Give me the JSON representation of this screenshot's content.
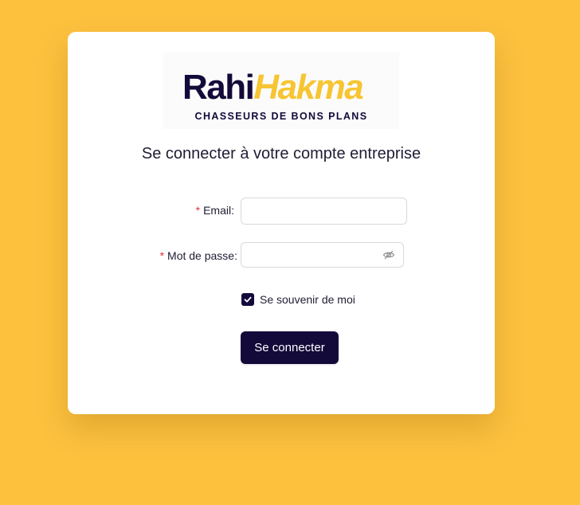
{
  "colors": {
    "background": "#fdc13e",
    "brand_dark": "#140a3a",
    "brand_yellow": "#f7c531",
    "required_star": "#e0353a"
  },
  "logo": {
    "word_dark": "Rahi",
    "word_yellow": "Hakma",
    "tagline": "CHASSEURS DE BONS PLANS"
  },
  "heading": "Se connecter à votre compte entreprise",
  "form": {
    "email": {
      "required_mark": "*",
      "label": "Email",
      "colon": ":",
      "value": ""
    },
    "password": {
      "required_mark": "*",
      "label": "Mot de passe",
      "colon": ":",
      "value": "",
      "toggle_icon": "eye-invisible-icon"
    },
    "remember": {
      "label": "Se souvenir de moi",
      "checked": true
    },
    "submit_label": "Se connecter"
  }
}
